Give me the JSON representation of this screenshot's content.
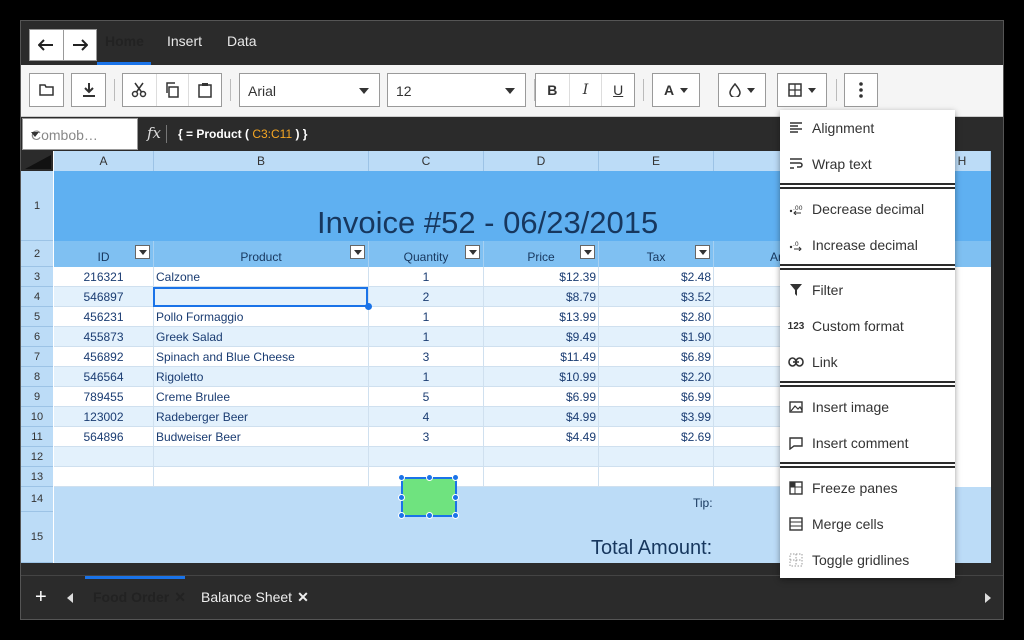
{
  "menu": {
    "tabs": [
      "Home",
      "Insert",
      "Data"
    ],
    "active": "Home"
  },
  "toolbar": {
    "font_name": "Arial",
    "font_size": "12",
    "bold": "B",
    "italic": "I",
    "underline": "U",
    "font_color_label": "A"
  },
  "formula_bar": {
    "namebox": "Combob…",
    "fx": "fx",
    "formula_prefix": "{ = Product ( ",
    "formula_ref": "C3:C11",
    "formula_suffix": " ) }"
  },
  "grid": {
    "columns": [
      "A",
      "B",
      "C",
      "D",
      "E",
      "",
      "H"
    ],
    "rows": [
      "1",
      "2",
      "3",
      "4",
      "5",
      "6",
      "7",
      "8",
      "9",
      "10",
      "11",
      "12",
      "13",
      "14",
      "15"
    ],
    "title": "Invoice #52 - 06/23/2015",
    "headers": [
      "ID",
      "Product",
      "Quantity",
      "Price",
      "Tax",
      "Ar"
    ],
    "data": [
      [
        "216321",
        "Calzone",
        "1",
        "$12.39",
        "$2.48"
      ],
      [
        "546897",
        "",
        "2",
        "$8.79",
        "$3.52"
      ],
      [
        "456231",
        "Pollo Formaggio",
        "1",
        "$13.99",
        "$2.80"
      ],
      [
        "455873",
        "Greek Salad",
        "1",
        "$9.49",
        "$1.90"
      ],
      [
        "456892",
        "Spinach and Blue Cheese",
        "3",
        "$11.49",
        "$6.89"
      ],
      [
        "546564",
        "Rigoletto",
        "1",
        "$10.99",
        "$2.20"
      ],
      [
        "789455",
        "Creme Brulee",
        "5",
        "$6.99",
        "$6.99"
      ],
      [
        "123002",
        "Radeberger Beer",
        "4",
        "$4.99",
        "$3.99"
      ],
      [
        "564896",
        "Budweiser Beer",
        "3",
        "$4.49",
        "$2.69"
      ]
    ],
    "tip_label": "Tip:",
    "total_label": "Total Amount:"
  },
  "popup_menu": [
    {
      "label": "Alignment",
      "icon": "align-left-icon"
    },
    {
      "label": "Wrap text",
      "icon": "wrap-text-icon"
    },
    {
      "label": "Decrease decimal",
      "icon": "decrease-decimal-icon"
    },
    {
      "label": "Increase decimal",
      "icon": "increase-decimal-icon"
    },
    {
      "label": "Filter",
      "icon": "filter-icon"
    },
    {
      "label": "Custom format",
      "icon": "custom-format-icon"
    },
    {
      "label": "Link",
      "icon": "link-icon"
    },
    {
      "label": "Insert image",
      "icon": "image-icon"
    },
    {
      "label": "Insert comment",
      "icon": "comment-icon"
    },
    {
      "label": "Freeze panes",
      "icon": "freeze-panes-icon"
    },
    {
      "label": "Merge cells",
      "icon": "merge-cells-icon"
    },
    {
      "label": "Toggle gridlines",
      "icon": "gridlines-icon"
    }
  ],
  "sheets": {
    "tabs": [
      "Food Order",
      "Balance Sheet"
    ],
    "active": "Food Order",
    "add_label": "+"
  },
  "colors": {
    "accent": "#1a73e8",
    "title_band": "#5fb0f1",
    "header_band": "#7fc0f2",
    "row_alt": "#e3f1fc",
    "shape_fill": "#6fe37f"
  }
}
